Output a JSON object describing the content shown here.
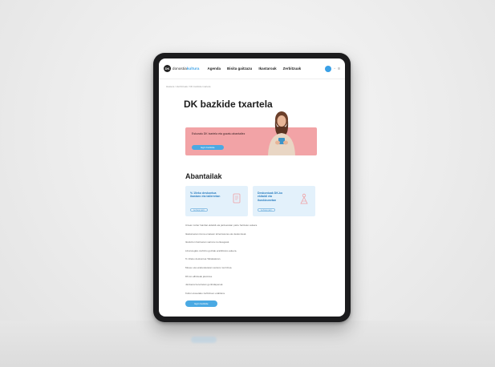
{
  "nav": {
    "logo_mark": "DK",
    "logo_prefix": "donostia",
    "logo_suffix": "kultura",
    "items": [
      {
        "label": "Agenda"
      },
      {
        "label": "Bisita gaitzazu"
      },
      {
        "label": "Ikastaroak"
      },
      {
        "label": "Zerbitzuak"
      }
    ],
    "right_icons": [
      "user-icon",
      "globe-icon",
      "menu-icon"
    ]
  },
  "breadcrumb": "Hasiera / Zerbitzuak / DK bazkide txartela",
  "page": {
    "title": "DK bazkide txartela"
  },
  "promo": {
    "text": "Eskuratu DK txartela eta gozatu abantailez",
    "button_label": "Egin bazkide"
  },
  "benefits": {
    "title": "Abantailak",
    "cards": [
      {
        "text": "% 10eko deskontua ikastaro eta tailerretan",
        "button_label": "Gehiago jakin",
        "icon": "document-icon"
      },
      {
        "text": "Deskontuak DK-ko ekitaldi eta ikuskizunetan",
        "button_label": "Gehiago jakin",
        "icon": "ticket-icon"
      }
    ]
  },
  "list_items": [
    "Urtean zehar hainbat ekitaldi eta jardueratan parte hartzeko aukera.",
    "Ikastaroetan izena ematean lehentasuna eta deskontuak.",
    "Ikuskizun batzuetan sarrera merkeagoak.",
    "Liburutegiko zerbitzu guztiak erabiltzeko aukera.",
    "% 10eko deskontua Tabakaleran.",
    "Museo eta erakusketetan sarrera murriztua.",
    "DK-ko albisteak jasotzea.",
    "Jarduera berezietan gonbidapenak.",
    "Kultur etxeetako zerbitzuen erabilera."
  ],
  "cta_label": "Egin bazkide",
  "colors": {
    "accent": "#4aa9e3",
    "promo_bg": "#f2a3a6",
    "card_bg": "#e3f1fb"
  }
}
